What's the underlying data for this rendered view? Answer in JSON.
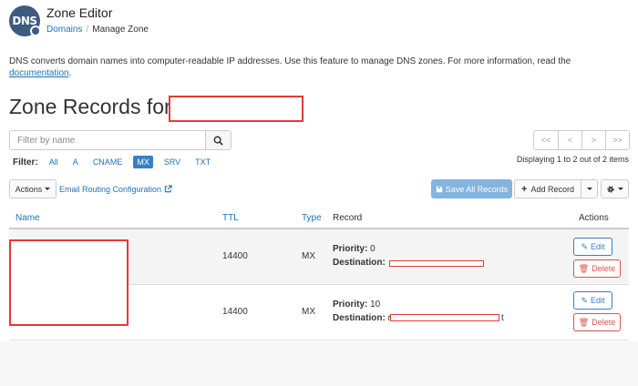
{
  "header": {
    "logo_text": "DNS",
    "title": "Zone Editor",
    "breadcrumb": {
      "root": "Domains",
      "current": "Manage Zone"
    }
  },
  "description": {
    "text": "DNS converts domain names into computer-readable IP addresses. Use this feature to manage DNS zones. For more information, read the",
    "link": "documentation",
    "end": "."
  },
  "zone": {
    "title_prefix": "Zone Records for"
  },
  "search": {
    "placeholder": "Filter by name",
    "icon": "search-icon"
  },
  "pagination": {
    "first": "<<",
    "prev": "<",
    "next": ">",
    "last": ">>"
  },
  "filter": {
    "label": "Filter:",
    "options": [
      "All",
      "A",
      "CNAME",
      "MX",
      "SRV",
      "TXT"
    ],
    "active": "MX"
  },
  "display_count": "Displaying 1 to 2 out of 2 items",
  "toolbar": {
    "actions_label": "Actions",
    "email_routing_label": "Email Routing Configuration",
    "save_all_label": "Save All Records",
    "add_record_label": "Add Record",
    "settings_icon": "gear-icon"
  },
  "table": {
    "headers": {
      "name": "Name",
      "ttl": "TTL",
      "type": "Type",
      "record": "Record",
      "actions": "Actions"
    },
    "rows": [
      {
        "ttl": "14400",
        "type": "MX",
        "priority_label": "Priority:",
        "priority": "0",
        "destination_label": "Destination:",
        "destination_prefix": "",
        "destination_suffix": ""
      },
      {
        "ttl": "14400",
        "type": "MX",
        "priority_label": "Priority:",
        "priority": "10",
        "destination_label": "Destination:",
        "destination_prefix": "r",
        "destination_suffix": "t"
      }
    ],
    "edit_label": "Edit",
    "delete_label": "Delete"
  },
  "colors": {
    "link": "#1b73b8",
    "active_filter": "#3a7fc1",
    "save_button": "#83b3df",
    "delete": "#d9534f",
    "redaction": "#e53935"
  }
}
